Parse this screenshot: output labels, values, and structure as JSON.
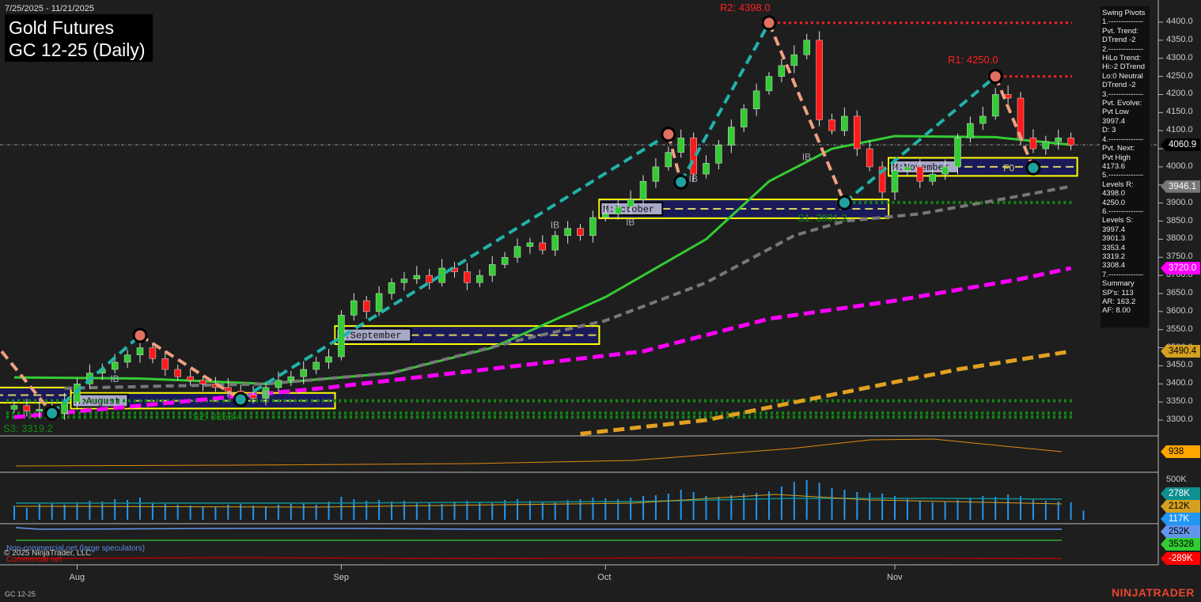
{
  "header": {
    "date_range": "7/25/2025 - 11/21/2025",
    "title_line1": "Gold Futures",
    "title_line2": "GC 12-25 (Daily)"
  },
  "swing_pivots_panel": [
    "Swing Pivots",
    "1.--------------",
    "Pvt. Trend:",
    "DTrend -2",
    "2.--------------",
    "HiLo Trend:",
    "Hi:-2 DTrend",
    "Lo:0 Neutral",
    "DTrend -2",
    "3.--------------",
    "Pvt. Evolve:",
    "Pvt Low",
    "3997.4",
    "D: 3",
    "4.--------------",
    "Pvt. Next:",
    "Pvt High",
    "4173.6",
    "5.--------------",
    "Levels R:",
    "4398.0",
    "4250.0",
    "6.--------------",
    "Levels S:",
    "3997.4",
    "3901.3",
    "3353.4",
    "3319.2",
    "3308.4",
    "7.--------------",
    "Summary",
    "SP's: 113",
    "AR: 163.2",
    "AF: 8.00"
  ],
  "price_tags": [
    {
      "value": "4060.9",
      "price": 4060.9,
      "bg": "#000000",
      "fg": "#ffffff"
    },
    {
      "value": "3946.1",
      "price": 3946.1,
      "bg": "#777777",
      "fg": "#ffffff"
    },
    {
      "value": "3720.0",
      "price": 3720.0,
      "bg": "#ff00ff",
      "fg": "#ffffff"
    },
    {
      "value": "3490.4",
      "price": 3490.4,
      "bg": "#d4a020",
      "fg": "#000000"
    }
  ],
  "sub_tags": {
    "p1": {
      "value": "938",
      "bg": "#ffa500",
      "fg": "#000"
    },
    "vol_axis": "500K",
    "oi": {
      "value": "278K",
      "bg": "#0f8f8f",
      "fg": "#fff"
    },
    "oi2": {
      "value": "212K",
      "bg": "#d4a020",
      "fg": "#000"
    },
    "vol": {
      "value": "117K",
      "bg": "#2196f3",
      "fg": "#fff"
    },
    "cot1": {
      "value": "252K",
      "bg": "#6495ed",
      "fg": "#000"
    },
    "cot2": {
      "value": "35328",
      "bg": "#32cd32",
      "fg": "#000"
    },
    "cot3": {
      "value": "-289K",
      "bg": "#ff0000",
      "fg": "#fff"
    }
  },
  "legend": {
    "noncommercial": "Non-commercial net (large speculators)",
    "commercial": "Commercial net",
    "copyright": "© 2025 NinjaTrader, LLC"
  },
  "footer": {
    "instrument": "GC 12-25",
    "brand": "NINJATRADER"
  },
  "chart_data": {
    "type": "candlestick",
    "title": "Gold Futures GC 12-25 (Daily)",
    "ylim": [
      3260,
      4460
    ],
    "yticks": [
      3300,
      3350,
      3400,
      3450,
      3500,
      3550,
      3600,
      3650,
      3700,
      3750,
      3800,
      3850,
      3900,
      3950,
      4000,
      4050,
      4100,
      4150,
      4200,
      4250,
      4300,
      4350,
      4400
    ],
    "months": [
      {
        "label": "Aug",
        "index": 5
      },
      {
        "label": "Sep",
        "index": 26
      },
      {
        "label": "Oct",
        "index": 47
      },
      {
        "label": "Nov",
        "index": 70
      }
    ],
    "closes": [
      3340,
      3325,
      3330,
      3318,
      3350,
      3400,
      3430,
      3440,
      3460,
      3480,
      3500,
      3470,
      3440,
      3420,
      3410,
      3400,
      3390,
      3380,
      3370,
      3360,
      3390,
      3410,
      3420,
      3440,
      3460,
      3475,
      3590,
      3630,
      3600,
      3650,
      3680,
      3690,
      3700,
      3680,
      3720,
      3710,
      3680,
      3700,
      3730,
      3750,
      3780,
      3790,
      3770,
      3810,
      3830,
      3810,
      3860,
      3870,
      3890,
      3910,
      3960,
      4000,
      4040,
      4080,
      3980,
      4010,
      4060,
      4110,
      4160,
      4210,
      4250,
      4280,
      4310,
      4350,
      4130,
      4100,
      4140,
      4050,
      4000,
      3930,
      3990,
      4000,
      3960,
      3980,
      4000,
      4080,
      4120,
      4140,
      4200,
      4190,
      4080,
      4050,
      4070,
      4080,
      4060
    ],
    "volume_k": [
      180,
      150,
      200,
      210,
      190,
      220,
      240,
      230,
      260,
      250,
      280,
      210,
      200,
      190,
      180,
      170,
      160,
      190,
      200,
      180,
      170,
      190,
      200,
      210,
      190,
      230,
      290,
      260,
      240,
      250,
      230,
      240,
      220,
      210,
      200,
      230,
      240,
      220,
      210,
      250,
      260,
      240,
      230,
      220,
      250,
      260,
      280,
      270,
      260,
      280,
      300,
      310,
      330,
      380,
      350,
      300,
      290,
      310,
      330,
      340,
      360,
      420,
      480,
      500,
      470,
      400,
      380,
      350,
      340,
      330,
      300,
      260,
      240,
      220,
      230,
      250,
      280,
      300,
      290,
      320,
      300,
      260,
      240,
      230,
      220,
      117
    ],
    "moving_averages": [
      {
        "name": "green",
        "color": "#33cc33",
        "points": [
          [
            0,
            3418
          ],
          [
            10,
            3415
          ],
          [
            20,
            3400
          ],
          [
            30,
            3430
          ],
          [
            38,
            3500
          ],
          [
            47,
            3640
          ],
          [
            55,
            3800
          ],
          [
            60,
            3960
          ],
          [
            65,
            4050
          ],
          [
            70,
            4085
          ],
          [
            78,
            4082
          ],
          [
            84,
            4061
          ]
        ]
      },
      {
        "name": "gray",
        "color": "#777777",
        "points": [
          [
            4,
            3388
          ],
          [
            20,
            3400
          ],
          [
            30,
            3430
          ],
          [
            40,
            3520
          ],
          [
            47,
            3575
          ],
          [
            55,
            3680
          ],
          [
            62,
            3810
          ],
          [
            66,
            3850
          ],
          [
            72,
            3870
          ],
          [
            80,
            3920
          ],
          [
            84,
            3946
          ]
        ]
      },
      {
        "name": "magenta",
        "color": "#ff00ff",
        "points": [
          [
            0,
            3308
          ],
          [
            10,
            3340
          ],
          [
            25,
            3390
          ],
          [
            40,
            3450
          ],
          [
            50,
            3490
          ],
          [
            60,
            3580
          ],
          [
            70,
            3630
          ],
          [
            80,
            3690
          ],
          [
            84,
            3720
          ]
        ]
      },
      {
        "name": "orange",
        "color": "#e0a020",
        "points": [
          [
            45,
            3262
          ],
          [
            55,
            3300
          ],
          [
            65,
            3370
          ],
          [
            75,
            3440
          ],
          [
            84,
            3490
          ]
        ]
      }
    ],
    "swings": [
      [
        -1,
        3490
      ],
      [
        3,
        3319
      ],
      [
        10,
        3534
      ],
      [
        18,
        3357
      ],
      [
        52,
        4090
      ],
      [
        53,
        3958
      ],
      [
        60,
        4398
      ],
      [
        66,
        3901
      ],
      [
        78,
        4250
      ],
      [
        81,
        3997
      ]
    ],
    "levels": [
      {
        "label": "R2: 4398.0",
        "price": 4398.0,
        "color": "#ff2020",
        "from": 60,
        "kind": "R"
      },
      {
        "label": "R1: 4250.0",
        "price": 4250.0,
        "color": "#ff2020",
        "from": 78,
        "kind": "R"
      },
      {
        "label": "S1: 3901.3",
        "price": 3901.3,
        "color": "#118811",
        "from": 66,
        "kind": "S"
      },
      {
        "label": "S2: 3353.4",
        "price": 3353.4,
        "color": "#118811",
        "from": 0,
        "kind": "S"
      },
      {
        "label": "S3: 3319.2",
        "price": 3319.2,
        "color": "#118811",
        "from": 0,
        "kind": "S"
      },
      {
        "label": "",
        "price": 3308.4,
        "color": "#118811",
        "from": 0,
        "kind": "S"
      }
    ],
    "month_boxes": [
      {
        "label": "M:August",
        "from": 5,
        "to": 25,
        "top": 3375,
        "bottom": 3332
      },
      {
        "label": "M:September",
        "from": 26,
        "to": 46,
        "top": 3560,
        "bottom": 3510
      },
      {
        "label": "M:October",
        "from": 47,
        "to": 69,
        "top": 3910,
        "bottom": 3858
      },
      {
        "label": "M:November",
        "from": 70,
        "to": 84,
        "top": 4025,
        "bottom": 3975
      },
      {
        "label": "",
        "from": -1,
        "to": 4,
        "top": 3390,
        "bottom": 3348
      }
    ],
    "annotations": [
      {
        "text": "IB",
        "index": 8,
        "price": 3405
      },
      {
        "text": "IB",
        "index": 20,
        "price": 3364
      },
      {
        "text": "IB",
        "index": 43,
        "price": 3830
      },
      {
        "text": "IB",
        "index": 49,
        "price": 3838
      },
      {
        "text": "IB",
        "index": 54,
        "price": 3958
      },
      {
        "text": "IB",
        "index": 63,
        "price": 4018
      },
      {
        "text": "F0",
        "index": 79,
        "price": 3988
      }
    ]
  }
}
